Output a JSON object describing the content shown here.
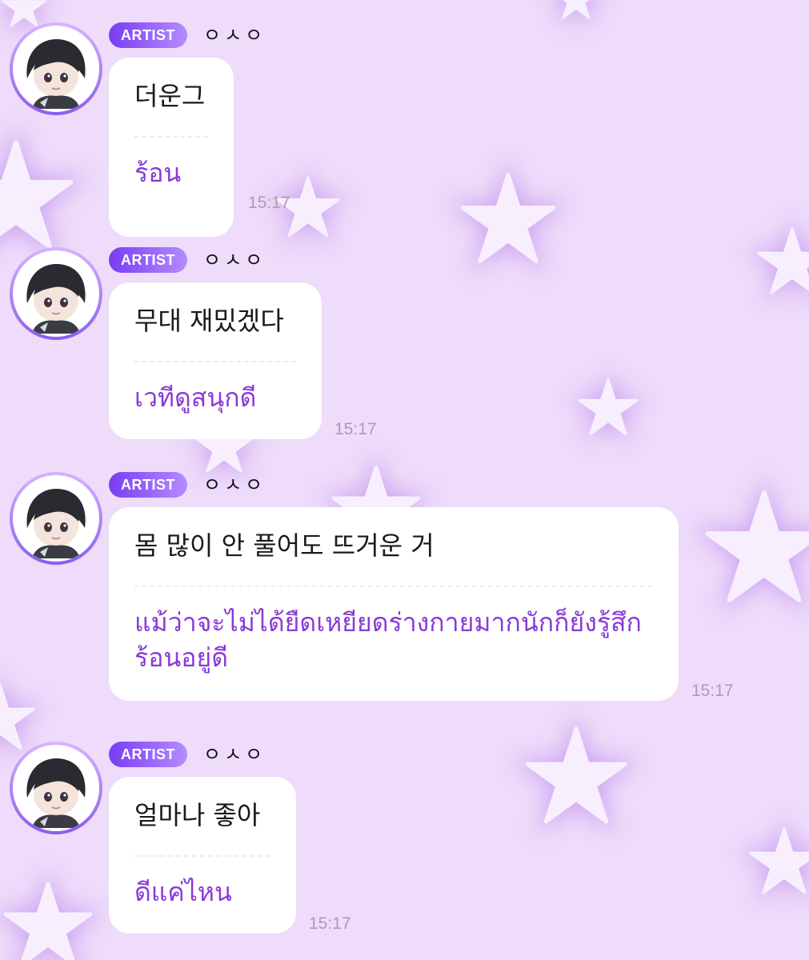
{
  "colors": {
    "background": "#eedcfa",
    "star": "#f7effd",
    "star_glow": "#c89af0",
    "bubble": "#ffffff",
    "korean_text": "#1a1a1a",
    "thai_text": "#8a3ad6",
    "badge_start": "#7a3cf3",
    "badge_end": "#b48cff",
    "timestamp": "#a79fb0"
  },
  "messages": [
    {
      "avatar_icon": "artist-avatar-icon",
      "badge": "ARTIST",
      "sender": "ㅇㅅㅇ",
      "korean": "더운그",
      "thai": "ร้อน",
      "time": "15:17"
    },
    {
      "avatar_icon": "artist-avatar-icon",
      "badge": "ARTIST",
      "sender": "ㅇㅅㅇ",
      "korean": "무대 재밌겠다",
      "thai": "เวทีดูสนุกดี",
      "time": "15:17"
    },
    {
      "avatar_icon": "artist-avatar-icon",
      "badge": "ARTIST",
      "sender": "ㅇㅅㅇ",
      "korean": "몸 많이 안 풀어도 뜨거운 거",
      "thai": "แม้ว่าจะไม่ได้ยืดเหยียดร่างกายมากนักก็ยังรู้สึกร้อนอยู่ดี",
      "time": "15:17"
    },
    {
      "avatar_icon": "artist-avatar-icon",
      "badge": "ARTIST",
      "sender": "ㅇㅅㅇ",
      "korean": "얼마나 좋아",
      "thai": "ดีแค่ไหน",
      "time": "15:17"
    }
  ]
}
